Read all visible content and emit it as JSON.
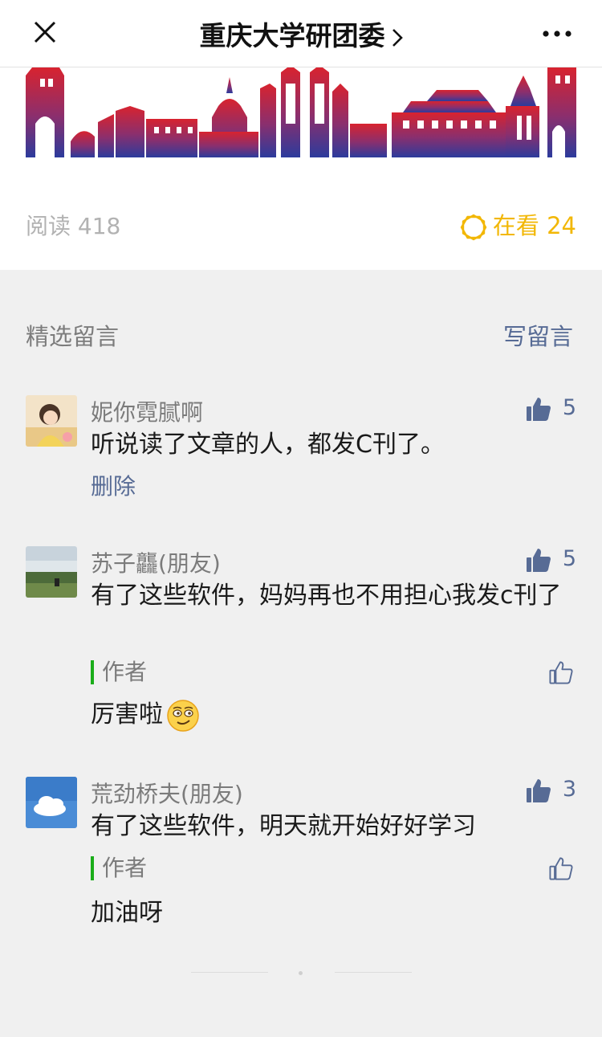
{
  "header": {
    "title": "重庆大学研团委"
  },
  "stats": {
    "read_label": "阅读 418",
    "zaikan_label": "在看",
    "zaikan_count": "24"
  },
  "comments_section": {
    "title": "精选留言",
    "write_label": "写留言"
  },
  "comments": [
    {
      "nickname": "妮你霓腻啊",
      "likes": "5",
      "text": "听说读了文章的人，都发C刊了。",
      "delete_label": "删除"
    },
    {
      "nickname": "苏子龘(朋友)",
      "likes": "5",
      "text": "有了这些软件，妈妈再也不用担心我发c刊了",
      "author_label": "作者",
      "reply": "厉害啦"
    },
    {
      "nickname": "荒劲桥夫(朋友)",
      "likes": "3",
      "text": "有了这些软件，明天就开始好好学习",
      "author_label": "作者",
      "reply": "加油呀"
    }
  ],
  "colors": {
    "link": "#576b95",
    "accent_gold": "#f2b705",
    "author_bar": "#1aad19"
  }
}
